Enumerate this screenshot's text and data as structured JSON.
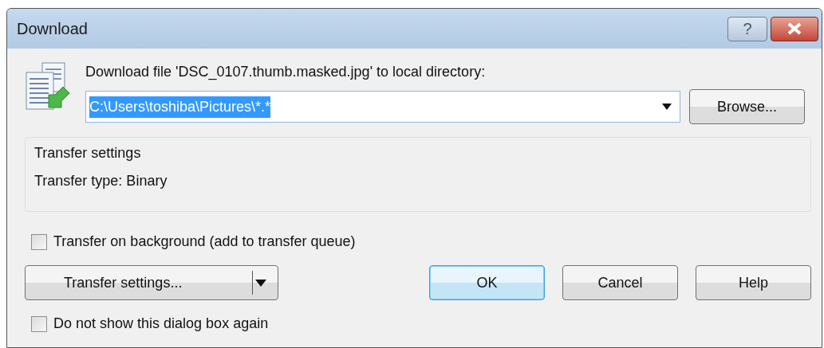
{
  "window": {
    "title": "Download"
  },
  "title_buttons": [
    {
      "kind": "help",
      "label": "?"
    },
    {
      "kind": "close"
    }
  ],
  "prompt": "Download file 'DSC_0107.thumb.masked.jpg' to local directory:",
  "directory": {
    "value": "C:\\Users\\toshiba\\Pictures\\*.*",
    "value_selected": true
  },
  "browse_button": "Browse...",
  "group": {
    "legend": "Transfer settings",
    "text": "Transfer type: Binary"
  },
  "options": [
    {
      "label": "Transfer on background (add to transfer queue)",
      "checked": false
    },
    {
      "label": "Do not show this dialog box again",
      "checked": false
    }
  ],
  "buttons": [
    {
      "kind": "split",
      "label": "Transfer settings...",
      "default": false
    },
    {
      "kind": "plain",
      "label": "OK",
      "default": true
    },
    {
      "kind": "plain",
      "label": "Cancel",
      "default": false
    },
    {
      "kind": "plain",
      "label": "Help",
      "default": false
    }
  ]
}
